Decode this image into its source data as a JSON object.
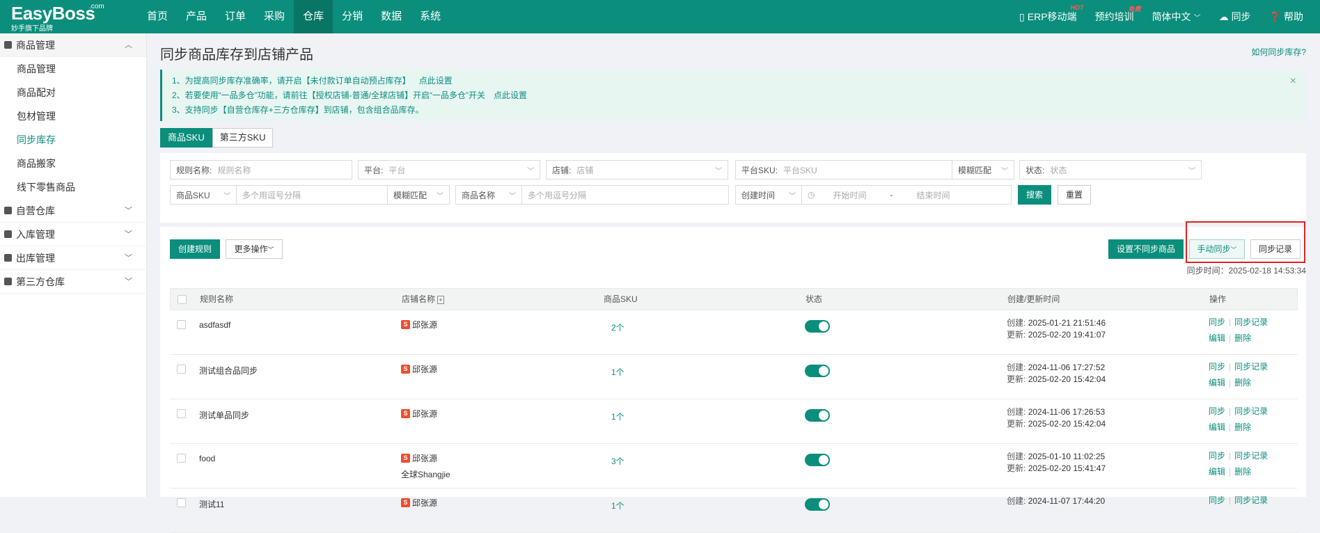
{
  "brand": {
    "name": "EasyBoss",
    "com": ".com",
    "sub": "妙手旗下品牌"
  },
  "nav": [
    "首页",
    "产品",
    "订单",
    "采购",
    "仓库",
    "分销",
    "数据",
    "系统"
  ],
  "nav_active": "仓库",
  "top_right": {
    "erp": "ERP移动端",
    "erp_badge": "HOT",
    "training": "预约培训",
    "training_badge": "免费",
    "lang": "简体中文",
    "sync": "同步",
    "help": "帮助"
  },
  "sidebar": {
    "group_product": "商品管理",
    "items": [
      "商品管理",
      "商品配对",
      "包材管理",
      "同步库存",
      "商品搬家",
      "线下零售商品"
    ],
    "active_item": "同步库存",
    "groups": [
      "自营仓库",
      "入库管理",
      "出库管理",
      "第三方仓库"
    ]
  },
  "page": {
    "title": "同步商品库存到店铺产品",
    "help_link": "如何同步库存?"
  },
  "notice": {
    "line1": "1、为提高同步库存准确率，请开启【未付款订单自动预占库存】",
    "line1_link": "点此设置",
    "line2": "2、若要使用“一品多仓”功能，请前往【授权店铺-普通/全球店铺】开启“一品多仓”开关",
    "line2_link": "点此设置",
    "line3": "3、支持同步【自营仓库存+三方仓库存】到店铺，包含组合品库存。",
    "close": "×"
  },
  "tabs": [
    "商品SKU",
    "第三方SKU"
  ],
  "filters": {
    "rule_name_label": "规则名称:",
    "rule_name_ph": "规则名称",
    "platform_label": "平台:",
    "platform_ph": "平台",
    "shop_label": "店铺:",
    "shop_ph": "店铺",
    "platform_sku_label": "平台SKU:",
    "platform_sku_ph": "平台SKU",
    "fuzzy": "模糊匹配",
    "status_label": "状态:",
    "status_ph": "状态",
    "sku_select": "商品SKU",
    "sku_ph": "多个用逗号分隔",
    "name_select": "商品名称",
    "name_ph": "多个用逗号分隔",
    "time_select": "创建时间",
    "start_ph": "开始时间",
    "end_ph": "结束时间",
    "dash": "-",
    "search": "搜索",
    "reset": "重置"
  },
  "actions": {
    "create": "创建规则",
    "more": "更多操作",
    "no_sync": "设置不同步商品",
    "manual_sync": "手动同步",
    "sync_log": "同步记录",
    "sync_time": "同步时间：2025-02-18 14:53:34"
  },
  "table": {
    "headers": [
      "规则名称",
      "店铺名称",
      "商品SKU",
      "状态",
      "创建/更新时间",
      "操作"
    ],
    "created_label": "创建:",
    "updated_label": "更新:",
    "op_sync": "同步",
    "op_log": "同步记录",
    "op_edit": "编辑",
    "op_delete": "删除",
    "rows": [
      {
        "name": "asdfasdf",
        "shop": "邱张源",
        "shop2": "",
        "sku": "2个",
        "created": "2025-01-21 21:51:46",
        "updated": "2025-02-20 19:41:07"
      },
      {
        "name": "测试组合品同步",
        "shop": "邱张源",
        "shop2": "",
        "sku": "1个",
        "created": "2024-11-06 17:27:52",
        "updated": "2025-02-20 15:42:04"
      },
      {
        "name": "测试单品同步",
        "shop": "邱张源",
        "shop2": "",
        "sku": "1个",
        "created": "2024-11-06 17:26:53",
        "updated": "2025-02-20 15:42:04"
      },
      {
        "name": "food",
        "shop": "邱张源",
        "shop2": "全球Shangjie",
        "sku": "3个",
        "created": "2025-01-10 11:02:25",
        "updated": "2025-02-20 15:41:47"
      },
      {
        "name": "测试11",
        "shop": "邱张源",
        "shop2": "",
        "sku": "1个",
        "created": "2024-11-07 17:44:20",
        "updated": ""
      }
    ]
  }
}
